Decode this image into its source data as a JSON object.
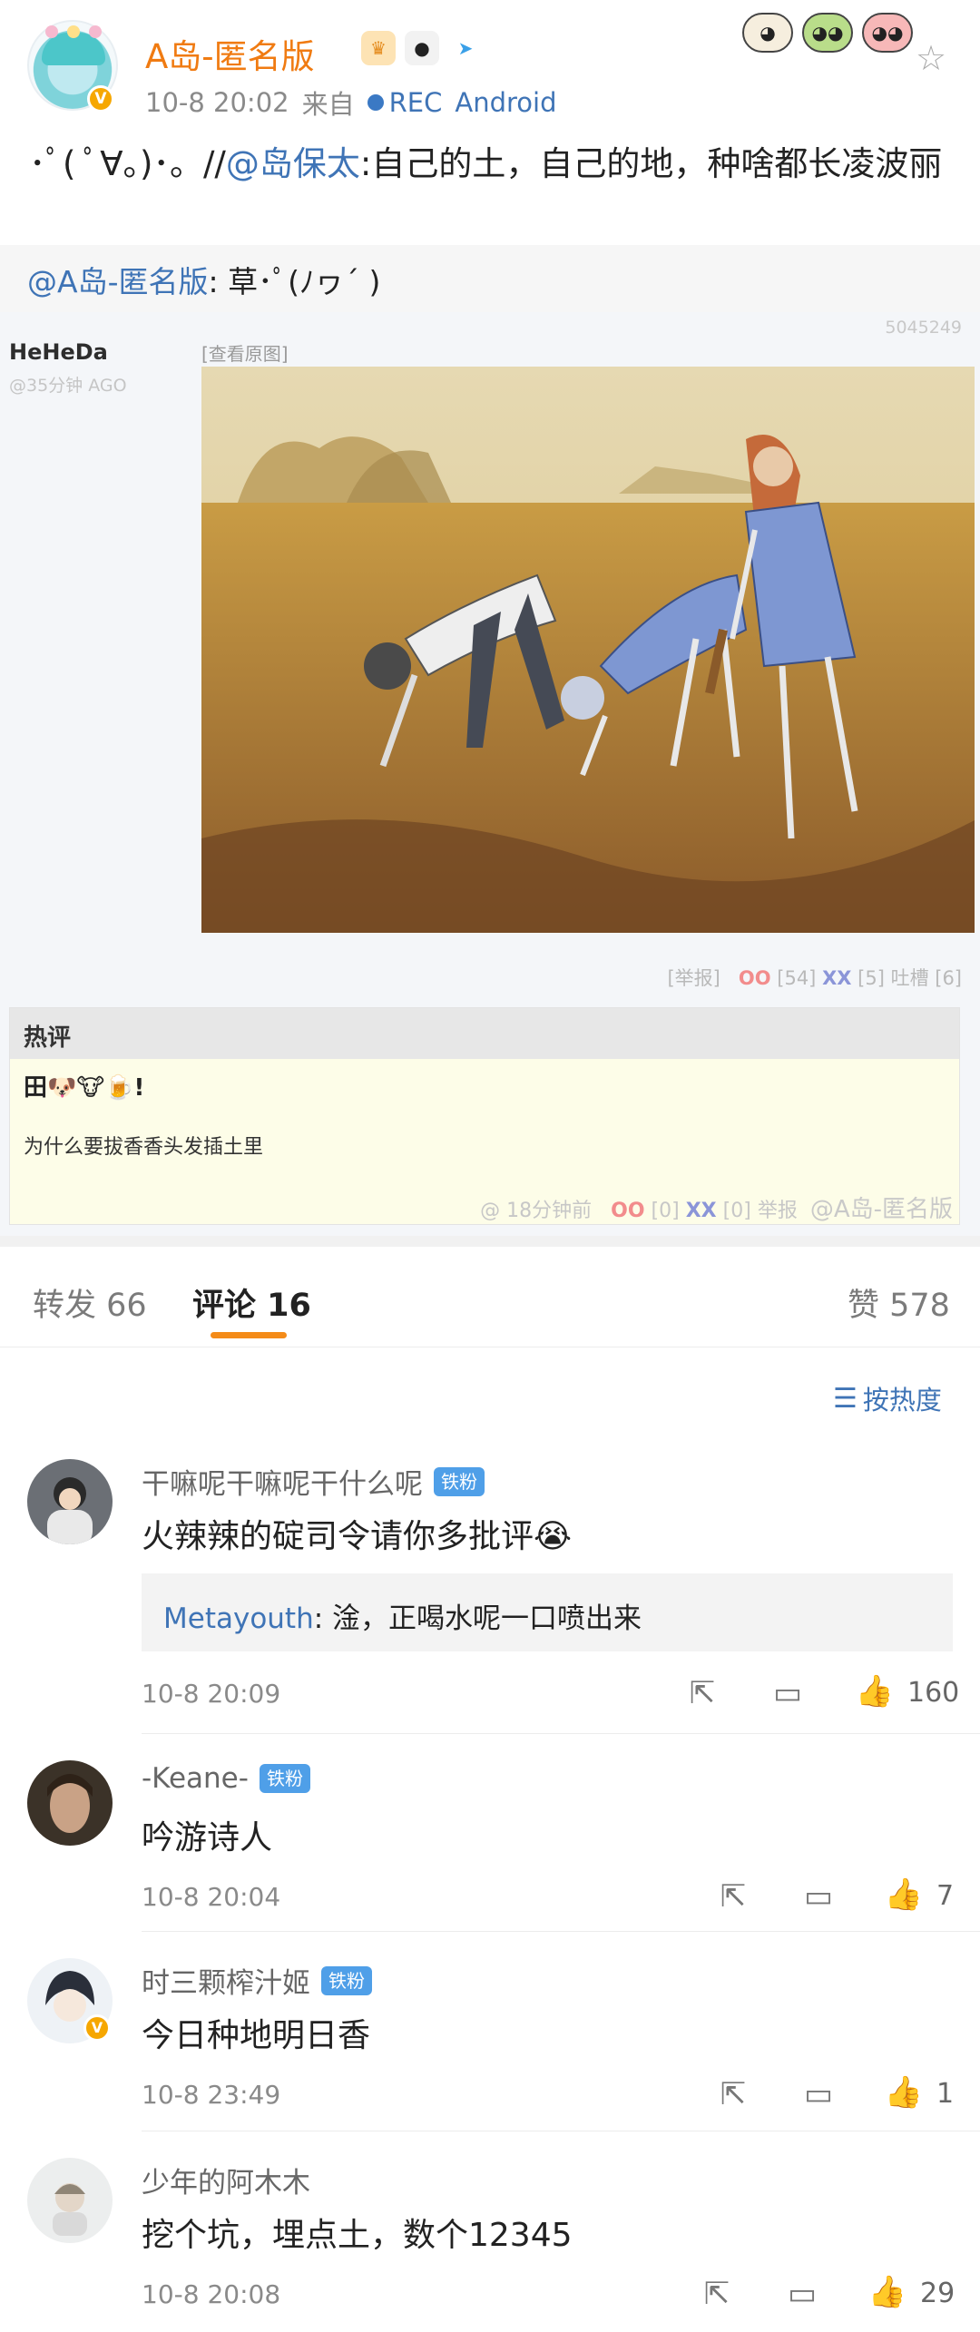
{
  "post": {
    "author": "A岛-匿名版",
    "time": "10-8 20:02",
    "from_prefix": "来自",
    "source": "REC",
    "device": "Android",
    "text_prefix": "･ﾟ( ﾟ∀。)･。//",
    "text_mention": "@岛保太",
    "text_body": ":自己的土，自己的地，种啥都长凌波丽",
    "repost_mention": "@A岛-匿名版",
    "repost_body": ": 草･ﾟ(ﾉヮ´ )",
    "icons": [
      "crown-icon",
      "panda-icon",
      "paper-plane-icon"
    ],
    "sticker_icons": [
      "chick-sticker",
      "frog-sticker",
      "pig-sticker"
    ]
  },
  "forum": {
    "thread_id": "5045249",
    "poster": "HeHeDa",
    "poster_time": "@35分钟 AGO",
    "view_original": "[查看原图]",
    "report": "[举报]",
    "oo_label": "OO",
    "oo_count": "[54]",
    "xx_label": "XX",
    "xx_count": "[5]",
    "tucao": "吐槽 [6]",
    "hot_title": "热评",
    "hot_emoji_line": "田🐶🐮🍺!",
    "hot_text": "为什么要拔香香头发插土里",
    "hot_footer": "@ 18分钟前",
    "hot_oo": "OO",
    "hot_counts": "[0]",
    "hot_xx": "XX",
    "hot_counts2": "[0] 举报",
    "watermark": "@A岛-匿名版"
  },
  "tabs": {
    "repost": "转发 66",
    "comments": "评论 16",
    "likes": "赞 578",
    "sort": "按热度"
  },
  "comments": [
    {
      "name": "干嘛呢干嘛呢干什么呢",
      "badge": "铁粉",
      "text": "火辣辣的碇司令请你多批评😭",
      "reply_name": "Metayouth",
      "reply_text": ": 淦，正喝水呢一口喷出来",
      "time": "10-8 20:09",
      "likes": "160"
    },
    {
      "name": "-Keane-",
      "badge": "铁粉",
      "text": "吟游诗人",
      "time": "10-8 20:04",
      "likes": "7"
    },
    {
      "name": "时三颗榨汁姬",
      "badge": "铁粉",
      "text": "今日种地明日香",
      "time": "10-8 23:49",
      "likes": "1"
    },
    {
      "name": "少年的阿木木",
      "text": "挖个坑，埋点土，数个12345",
      "time": "10-8 20:08",
      "likes": "29"
    }
  ],
  "colors": {
    "author_orange": "#f07b12",
    "link_blue": "#3f74b6",
    "tab_indicator": "#f48b18",
    "fan_badge": "#4f9fe8"
  }
}
